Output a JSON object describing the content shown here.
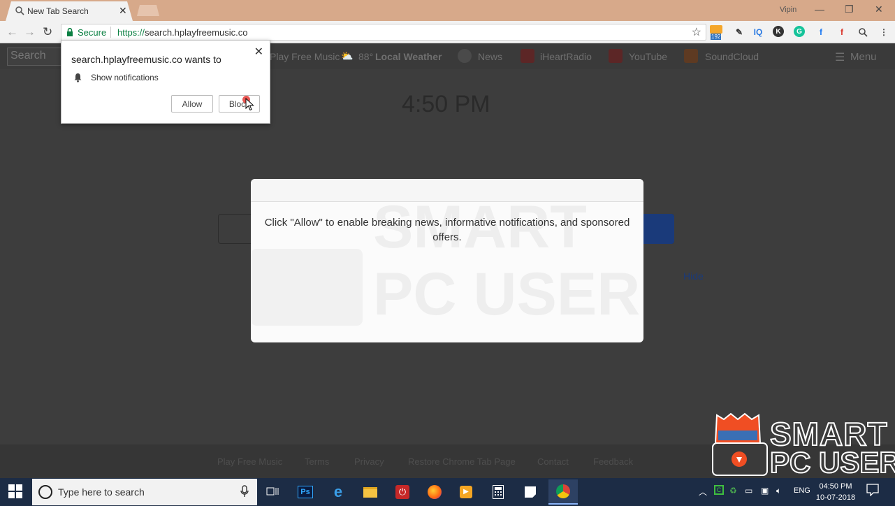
{
  "browser": {
    "tab_title": "New Tab Search",
    "profile_name": "Vipin",
    "security_label": "Secure",
    "url_scheme": "https://",
    "url_host": "search.hplayfreemusic.co",
    "ext_badge": "192"
  },
  "page": {
    "search_placeholder": "Search",
    "nav_links": [
      "Play Free Music",
      "88°",
      "Local Weather",
      "News",
      "iHeartRadio",
      "YouTube",
      "SoundCloud"
    ],
    "menu_label": "Menu",
    "clock": "4:50 PM",
    "hide_label": "Hide",
    "footer_links": [
      "Play Free Music",
      "Terms",
      "Privacy",
      "Restore Chrome Tab Page",
      "Contact",
      "Feedback"
    ]
  },
  "modal": {
    "message": "Click \"Allow\" to enable breaking news, informative notifications, and sponsored offers."
  },
  "permission_popup": {
    "title": "search.hplayfreemusic.co wants to",
    "permission": "Show notifications",
    "allow_label": "Allow",
    "block_label": "Block"
  },
  "watermark": {
    "line1": "SMART",
    "line2": "PC USER"
  },
  "taskbar": {
    "search_placeholder": "Type here to search",
    "language": "ENG",
    "time": "04:50 PM",
    "date": "10-07-2018"
  },
  "colors": {
    "chrome_frame": "#d7a98a",
    "secure_green": "#0b8043",
    "taskbar": "#1c2c45",
    "logo_orange": "#f04e23"
  }
}
